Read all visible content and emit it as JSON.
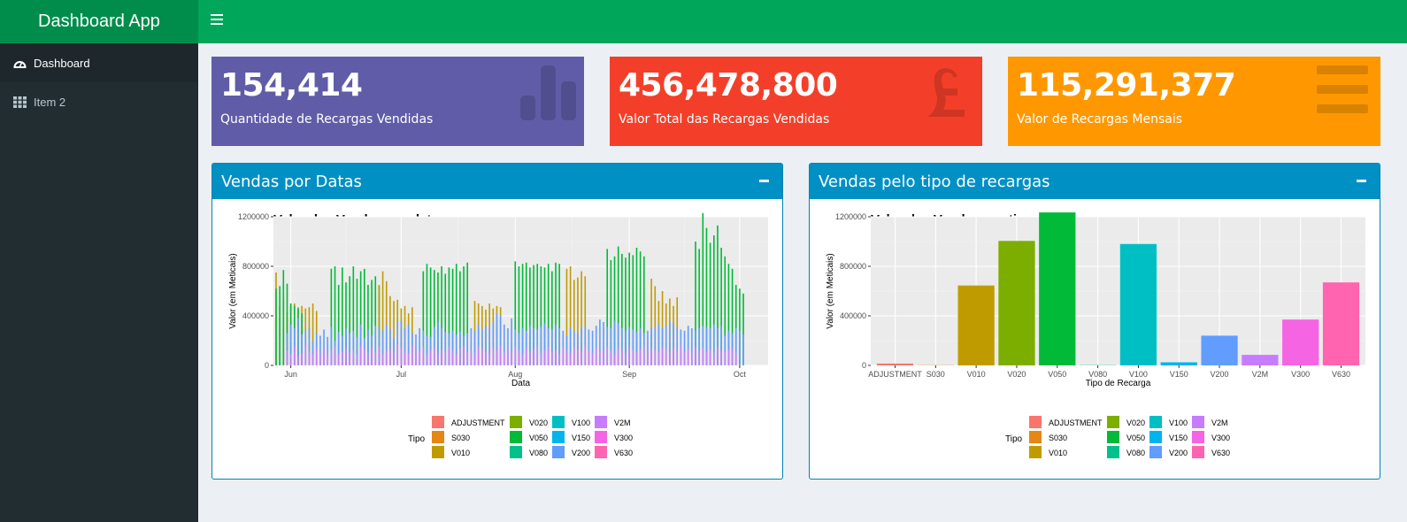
{
  "app": {
    "title": "Dashboard App"
  },
  "sidebar": {
    "items": [
      {
        "label": "Dashboard"
      },
      {
        "label": "Item 2"
      }
    ]
  },
  "value_boxes": [
    {
      "value": "154,414",
      "label": "Quantidade de Recargas Vendidas",
      "color": "#605ca8",
      "icon": "bar-chart-icon"
    },
    {
      "value": "456,478,800",
      "label": "Valor Total das Recargas Vendidas",
      "color": "#f33f2a",
      "icon": "pound-icon"
    },
    {
      "value": "115,291,377",
      "label": "Valor de Recargas Mensais",
      "color": "#ff9800",
      "icon": "menu-icon"
    }
  ],
  "panels": [
    {
      "title": "Vendas por Datas"
    },
    {
      "title": "Vendas pelo tipo de recargas"
    }
  ],
  "legend": {
    "title": "Tipo",
    "items": [
      {
        "name": "ADJUSTMENT",
        "color": "#F8766D"
      },
      {
        "name": "S030",
        "color": "#E68613"
      },
      {
        "name": "V010",
        "color": "#C09B00"
      },
      {
        "name": "V020",
        "color": "#7CAE00"
      },
      {
        "name": "V050",
        "color": "#00BA38"
      },
      {
        "name": "V080",
        "color": "#00C08B"
      },
      {
        "name": "V100",
        "color": "#00BFC4"
      },
      {
        "name": "V150",
        "color": "#00B4F0"
      },
      {
        "name": "V200",
        "color": "#619CFF"
      },
      {
        "name": "V2M",
        "color": "#C77CFF"
      },
      {
        "name": "V300",
        "color": "#F564E3"
      },
      {
        "name": "V630",
        "color": "#FF64B0"
      }
    ]
  },
  "chart_data": [
    {
      "type": "bar",
      "title": "Valor das Vendas por data",
      "xlabel": "Data",
      "ylabel": "Valor (em Meticais)",
      "xticks": [
        "Jun",
        "Jul",
        "Aug",
        "Sep",
        "Oct"
      ],
      "yticks": [
        "0",
        "400000",
        "800000",
        "1200000"
      ],
      "ylim": [
        0,
        1200000
      ],
      "grid": true,
      "legend_placement": "bottom",
      "x_start": "2018-05-28",
      "groups": [
        {
          "series": "V010",
          "start_day": 0,
          "values": [
            750000,
            480000,
            520000,
            430000,
            480000,
            500000,
            470000,
            480000,
            460000,
            470000,
            500000,
            440000
          ]
        },
        {
          "series": "V050",
          "start_day": 0,
          "values": [
            620000,
            640000,
            770000,
            660000,
            500000,
            480000,
            460000,
            420000
          ]
        },
        {
          "series": "V050",
          "start_day": 15,
          "values": [
            780000,
            800000,
            650000,
            790000,
            670000,
            720000,
            800000,
            700000,
            760000,
            780000,
            650000,
            690000,
            720000,
            640000
          ]
        },
        {
          "series": "V010",
          "start_day": 28,
          "values": [
            650000,
            760000,
            680000,
            560000,
            520000,
            530000,
            460000,
            480000,
            420000,
            470000
          ]
        },
        {
          "series": "V050",
          "start_day": 40,
          "values": [
            760000,
            820000,
            790000,
            770000,
            750000,
            800000,
            740000,
            790000,
            780000,
            820000,
            760000,
            800000,
            830000
          ]
        },
        {
          "series": "V010",
          "start_day": 54,
          "values": [
            520000,
            500000,
            480000,
            450000,
            500000,
            460000,
            480000,
            470000
          ]
        },
        {
          "series": "V050",
          "start_day": 65,
          "values": [
            840000,
            800000,
            820000,
            830000,
            790000,
            810000,
            820000,
            800000,
            790000,
            820000,
            760000,
            830000,
            820000
          ]
        },
        {
          "series": "V010",
          "start_day": 79,
          "values": [
            780000,
            800000,
            690000,
            710000,
            760000,
            720000
          ]
        },
        {
          "series": "V050",
          "start_day": 90,
          "values": [
            940000,
            850000,
            880000,
            960000,
            900000,
            870000,
            910000,
            890000,
            950000,
            920000,
            880000
          ]
        },
        {
          "series": "V010",
          "start_day": 102,
          "values": [
            700000,
            640000,
            520000,
            600000,
            500000,
            540000,
            480000,
            550000
          ]
        },
        {
          "series": "V050",
          "start_day": 114,
          "values": [
            1000000,
            940000,
            1230000,
            1110000,
            990000,
            1050000,
            1130000,
            950000,
            880000,
            820000,
            780000,
            650000,
            620000,
            580000
          ]
        },
        {
          "series": "V200",
          "start_day": 3,
          "values": [
            260000,
            330000,
            300000,
            380000,
            250000,
            280000,
            300000,
            200000,
            260000,
            240000,
            290000,
            230000,
            310000,
            200000,
            270000,
            240000,
            300000,
            260000,
            280000,
            230000,
            330000,
            220000,
            290000,
            240000,
            320000,
            310000,
            280000,
            330000,
            290000,
            220000,
            350000,
            360000,
            300000,
            330000,
            260000,
            250000,
            300000,
            280000,
            240000,
            230000,
            310000,
            350000,
            300000,
            270000,
            260000,
            280000,
            250000,
            270000,
            240000,
            260000,
            300000,
            280000,
            330000,
            290000,
            320000,
            300000,
            350000,
            420000,
            400000,
            330000,
            300000,
            380000,
            290000,
            260000,
            300000,
            280000,
            320000,
            300000,
            290000,
            310000,
            340000,
            300000,
            290000,
            330000,
            300000,
            280000,
            240000,
            300000,
            280000,
            260000,
            300000,
            320000,
            290000,
            280000,
            320000,
            370000,
            350000,
            310000,
            300000,
            360000,
            340000,
            300000,
            280000,
            310000,
            290000,
            270000,
            300000,
            260000,
            280000,
            300000,
            310000,
            330000,
            300000,
            320000,
            360000,
            340000,
            300000,
            290000,
            280000,
            320000,
            300000,
            280000,
            300000,
            320000,
            310000,
            300000,
            330000,
            300000,
            320000,
            240000,
            280000,
            260000,
            300000,
            280000,
            250000
          ]
        },
        {
          "series": "V2M",
          "start_day": 3,
          "values": [
            120000,
            90000,
            150000,
            80000,
            100000,
            160000,
            110000,
            90000,
            130000,
            100000,
            140000,
            80000,
            120000,
            150000,
            90000,
            110000,
            140000,
            100000,
            120000,
            90000,
            160000,
            130000,
            100000,
            140000,
            110000,
            150000,
            90000,
            120000,
            130000,
            100000,
            170000,
            140000,
            120000,
            100000,
            160000,
            130000,
            110000,
            150000,
            90000,
            120000,
            140000,
            100000,
            130000,
            110000,
            150000,
            120000,
            90000,
            140000,
            160000,
            110000,
            120000,
            100000,
            150000,
            130000,
            110000,
            90000,
            140000,
            120000,
            160000,
            100000,
            130000,
            110000,
            150000,
            120000,
            90000,
            140000,
            110000,
            130000,
            160000,
            100000,
            120000,
            150000,
            110000,
            130000,
            90000,
            140000,
            120000,
            100000,
            150000,
            130000,
            110000,
            160000,
            120000,
            100000,
            140000,
            130000,
            110000,
            150000,
            120000,
            90000,
            140000,
            130000,
            100000,
            150000,
            120000,
            110000,
            130000,
            160000,
            100000,
            140000,
            120000,
            110000,
            150000,
            130000,
            100000,
            140000,
            120000,
            160000,
            110000,
            130000,
            100000,
            150000,
            120000,
            140000,
            110000,
            130000,
            100000,
            150000,
            120000,
            110000,
            130000,
            140000,
            100000
          ]
        }
      ]
    },
    {
      "type": "bar",
      "title": "Valor das Vendas por tipo",
      "xlabel": "Tipo de Recarga",
      "ylabel": "Valor (em Meticais)",
      "ylim": [
        0,
        1200000
      ],
      "yticks": [
        "0",
        "400000",
        "800000",
        "1200000"
      ],
      "grid": true,
      "legend_placement": "bottom",
      "categories": [
        "ADJUSTMENT",
        "S030",
        "V010",
        "V020",
        "V050",
        "V080",
        "V100",
        "V150",
        "V200",
        "V2M",
        "V300",
        "V630"
      ],
      "values": [
        15000,
        2000,
        645000,
        1005000,
        1235000,
        2000,
        980000,
        25000,
        240000,
        85000,
        370000,
        670000
      ]
    }
  ]
}
